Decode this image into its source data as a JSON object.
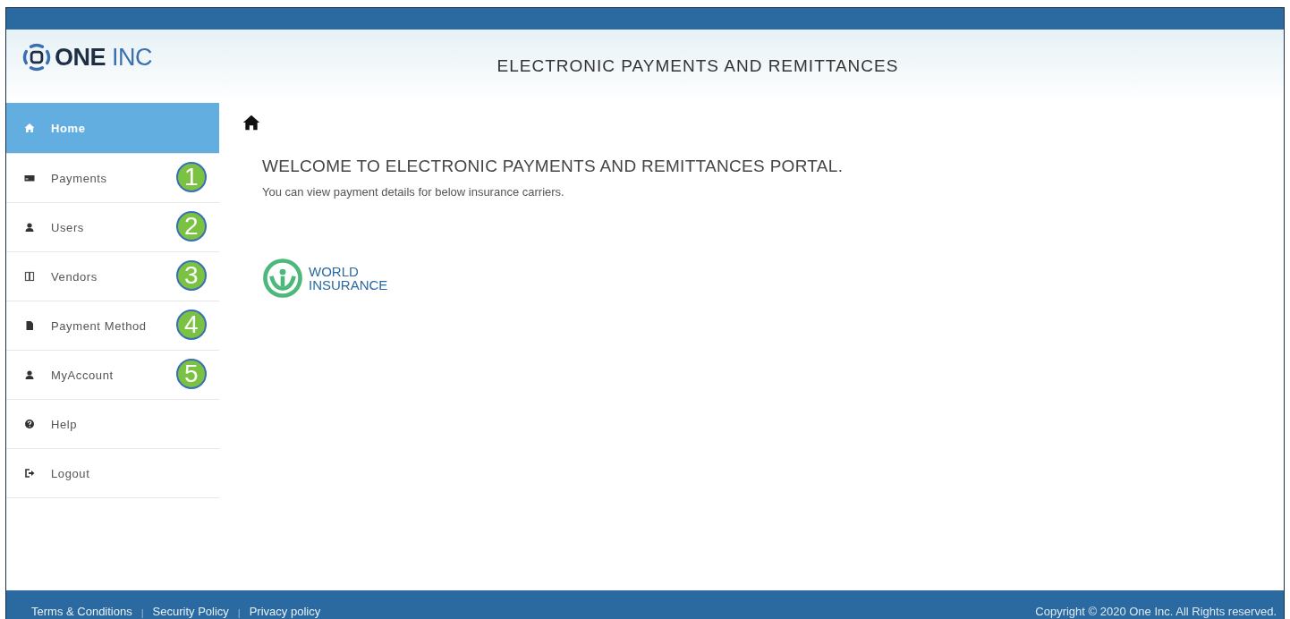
{
  "logo": {
    "bold": "ONE",
    "light": "INC"
  },
  "header": {
    "title": "ELECTRONIC PAYMENTS AND REMITTANCES"
  },
  "sidebar": {
    "items": [
      {
        "label": "Home",
        "kind": "home",
        "selected": true
      },
      {
        "label": "Payments",
        "kind": "card",
        "selected": false,
        "callout": "1"
      },
      {
        "label": "Users",
        "kind": "user",
        "selected": false,
        "callout": "2"
      },
      {
        "label": "Vendors",
        "kind": "columns",
        "selected": false,
        "callout": "3"
      },
      {
        "label": "Payment Method",
        "kind": "file",
        "selected": false,
        "callout": "4"
      },
      {
        "label": "MyAccount",
        "kind": "user",
        "selected": false,
        "callout": "5"
      },
      {
        "label": "Help",
        "kind": "help",
        "selected": false
      },
      {
        "label": "Logout",
        "kind": "logout",
        "selected": false
      }
    ]
  },
  "main": {
    "heading": "WELCOME TO ELECTRONIC PAYMENTS AND REMITTANCES PORTAL.",
    "text": "You can view payment details for below insurance carriers.",
    "carriers": [
      {
        "name_line_1": "WORLD",
        "name_line_2": "INSURANCE"
      }
    ]
  },
  "footer": {
    "items": [
      {
        "kind": "link",
        "text": "Terms & Conditions"
      },
      {
        "kind": "separator",
        "text": "|"
      },
      {
        "kind": "link",
        "text": "Security Policy"
      },
      {
        "kind": "separator",
        "text": "|"
      },
      {
        "kind": "link",
        "text": "Privacy policy"
      }
    ],
    "copyright": "Copyright © 2020 One Inc. All Rights reserved."
  }
}
